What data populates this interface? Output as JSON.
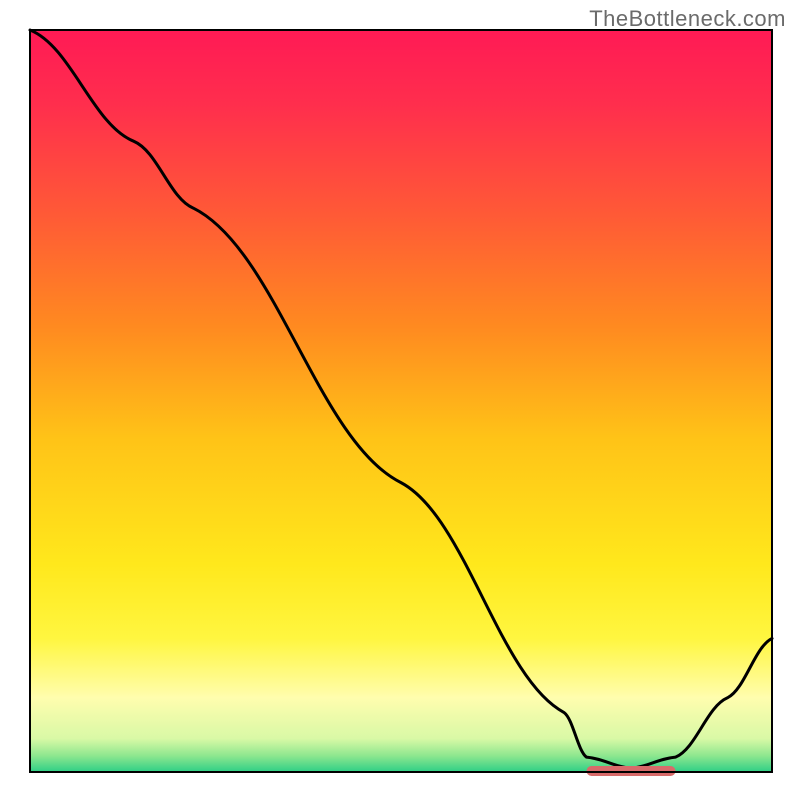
{
  "watermark": "TheBottleneck.com",
  "background": {
    "main_gradient_stops": [
      {
        "offset": 0.0,
        "color": "#ff1a55"
      },
      {
        "offset": 0.1,
        "color": "#ff2e4d"
      },
      {
        "offset": 0.25,
        "color": "#ff5a36"
      },
      {
        "offset": 0.4,
        "color": "#ff8a20"
      },
      {
        "offset": 0.55,
        "color": "#ffc317"
      },
      {
        "offset": 0.72,
        "color": "#ffe81c"
      },
      {
        "offset": 0.82,
        "color": "#fff640"
      },
      {
        "offset": 0.9,
        "color": "#fffdae"
      },
      {
        "offset": 0.955,
        "color": "#d9f9a6"
      },
      {
        "offset": 0.978,
        "color": "#8ee78f"
      },
      {
        "offset": 1.0,
        "color": "#2ecf86"
      }
    ]
  },
  "curve": {
    "stroke": "#000000",
    "stroke_width": 3
  },
  "marker": {
    "fill": "#d86a6a"
  },
  "chart_data": {
    "type": "line",
    "title": "",
    "xlabel": "",
    "ylabel": "",
    "x": [
      0,
      22,
      78,
      84,
      88,
      100
    ],
    "values": [
      100,
      76,
      3,
      0,
      3,
      18
    ],
    "ylim": [
      0,
      100
    ],
    "xlim": [
      0,
      100
    ],
    "optimum_band": {
      "x_start": 75,
      "x_end": 87,
      "value": 0
    },
    "notes": "Values are read as percentage of plot height from bottom (0) to top (100); x as percentage of plot width. Curve shows a steep descent with an inflection near x≈22, a minimum plateau (marker band) around x≈75–87 at y≈0, then a rise toward the right edge."
  }
}
